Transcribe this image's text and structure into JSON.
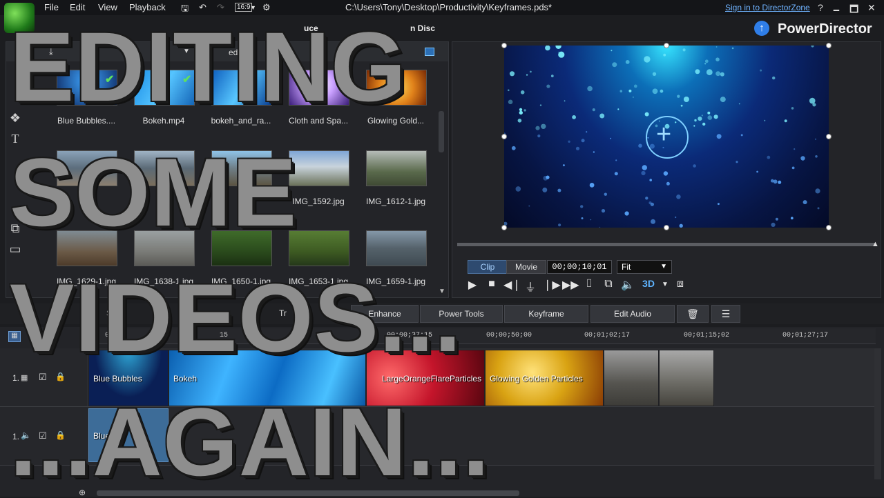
{
  "menubar": {
    "items": [
      "File",
      "Edit",
      "View",
      "Playback"
    ],
    "aspect_badge": "16:9",
    "window_title": "C:\\Users\\Tony\\Desktop\\Productivity\\Keyframes.pds*",
    "sign_in": "Sign in to DirectorZone",
    "help": "?",
    "minimize": "🗕",
    "maximize": "🗖",
    "close": "✕"
  },
  "brand": {
    "name": "PowerDirector"
  },
  "main_tabs": [
    "uce",
    "n Disc"
  ],
  "library": {
    "media_label": "edia",
    "items": [
      {
        "label": "Blue Bubbles....",
        "checked": true
      },
      {
        "label": "Bokeh.mp4",
        "checked": true
      },
      {
        "label": "bokeh_and_ra...",
        "checked": false
      },
      {
        "label": "Cloth and Spa...",
        "checked": false
      },
      {
        "label": "Glowing Gold...",
        "checked": false
      },
      {
        "label": "",
        "checked": false
      },
      {
        "label": "",
        "checked": false
      },
      {
        "label": "",
        "checked": false
      },
      {
        "label": "IMG_1592.jpg",
        "checked": false
      },
      {
        "label": "IMG_1612-1.jpg",
        "checked": false
      },
      {
        "label": "IMG_1629-1.jpg",
        "checked": false
      },
      {
        "label": "IMG_1638-1.jpg",
        "checked": false
      },
      {
        "label": "IMG_1650-1.jpg",
        "checked": false
      },
      {
        "label": "IMG_1653-1.jpg",
        "checked": false
      },
      {
        "label": "IMG_1659-1.jpg",
        "checked": false
      }
    ]
  },
  "preview": {
    "clip_label": "Clip",
    "movie_label": "Movie",
    "timecode": "00;00;10;01",
    "fit": "Fit",
    "stereo_label": "3D"
  },
  "edit_toolbar": {
    "enhance": "Enhance",
    "power_tools": "Power Tools",
    "keyframe": "Keyframe",
    "edit_audio": "Edit Audio",
    "partial_1": "S",
    "partial_2": "Tr"
  },
  "timeline": {
    "ruler": [
      "0",
      "15",
      "00;00;37;15",
      "00;00;50;00",
      "00;01;02;17",
      "00;01;15;02",
      "00;01;27;17"
    ],
    "tracks": [
      {
        "number": "1.",
        "type": "video"
      },
      {
        "number": "1.",
        "type": "audio"
      }
    ],
    "video_clips": [
      {
        "label": "Blue Bubbles",
        "color": "#0a1f55"
      },
      {
        "label": "Bokeh",
        "color": "#1c8ee0"
      },
      {
        "label": "LargeOrangeFlareParticles",
        "color": "#c4152b"
      },
      {
        "label": "Glowing Golden Particles",
        "color": "#d9a313"
      },
      {
        "label": "",
        "color": "#6f6f6f"
      },
      {
        "label": "",
        "color": "#7a7a7a"
      }
    ],
    "audio_clips": [
      {
        "label": "Blue Bu"
      }
    ]
  },
  "overlay": {
    "line1": "EDITING",
    "line2": "SOME",
    "line3": "VIDEOS...",
    "line4": "...AGAIN..."
  }
}
